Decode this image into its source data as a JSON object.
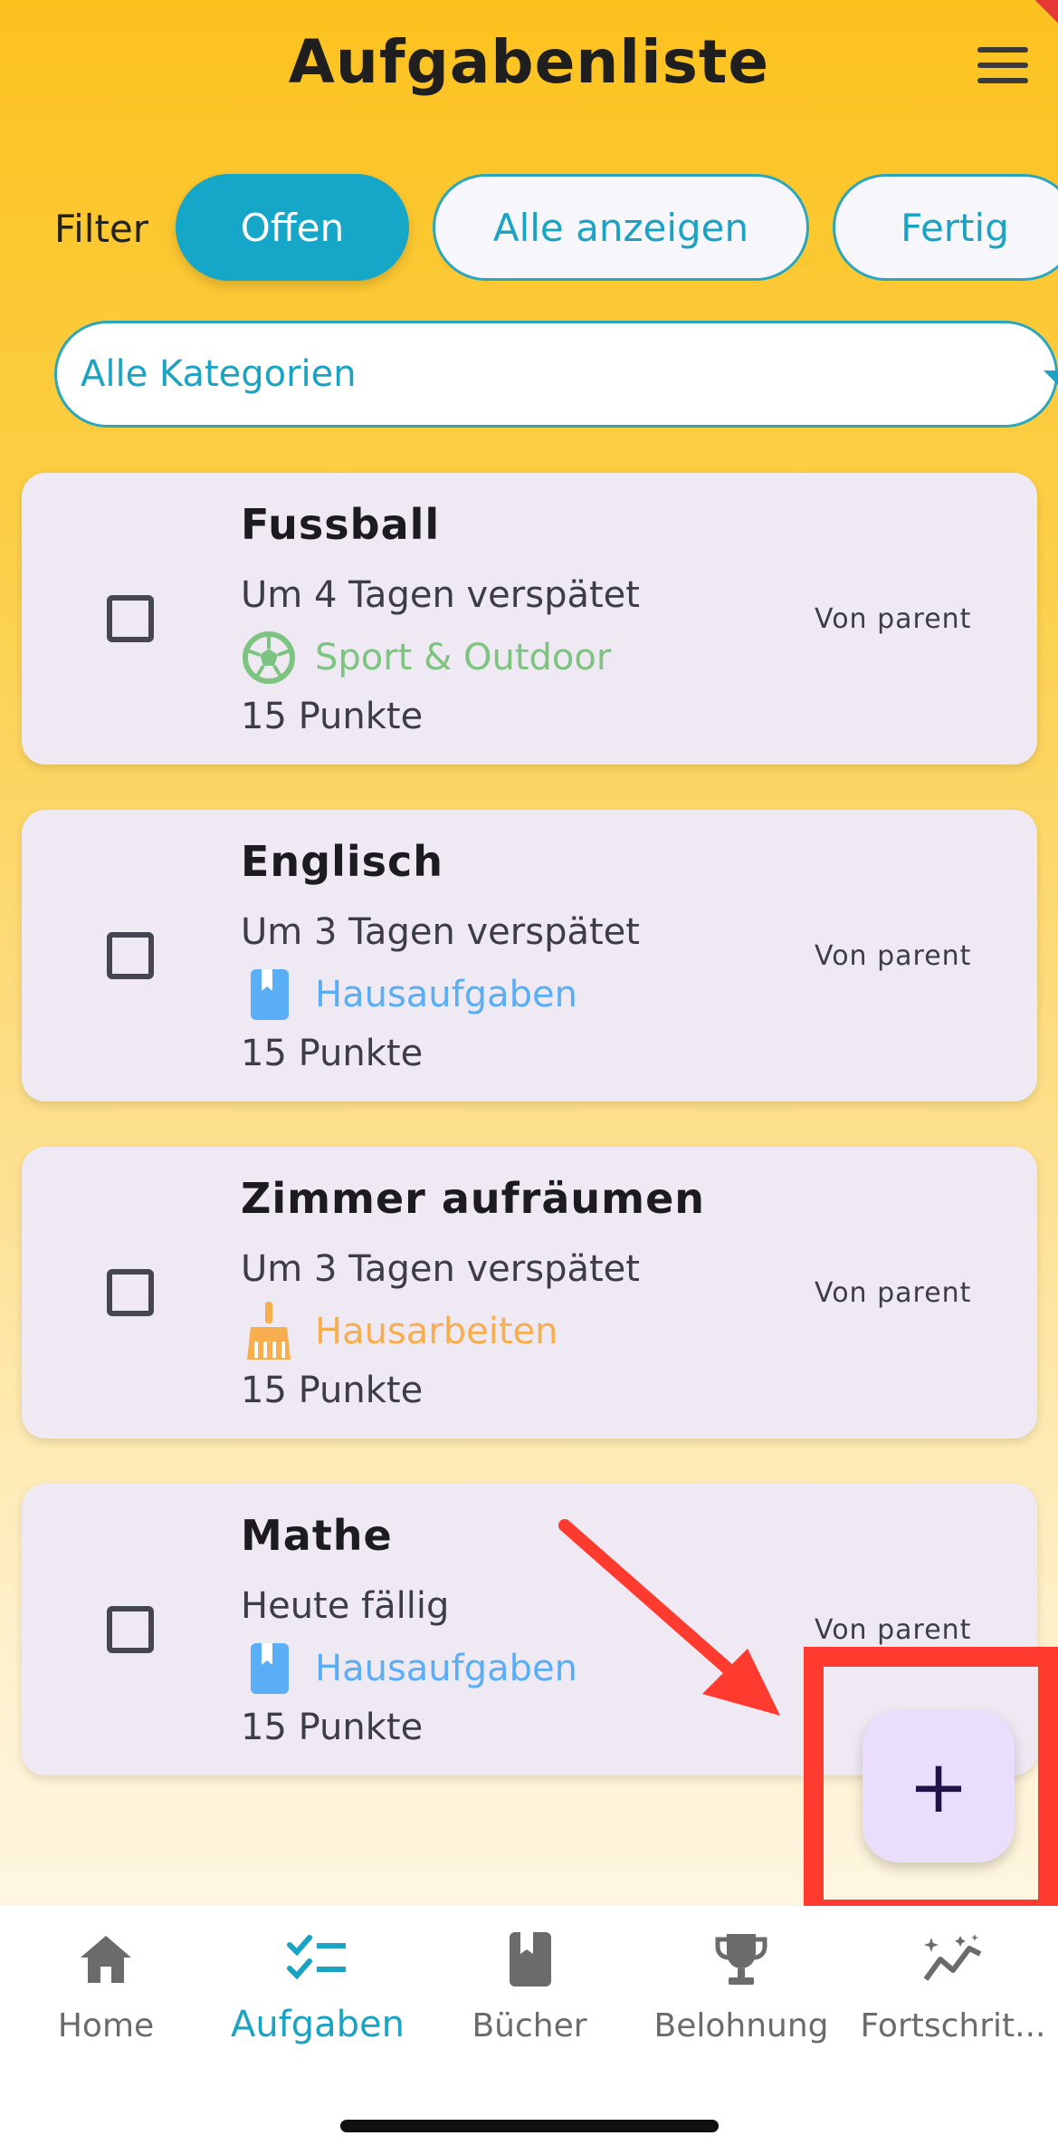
{
  "header": {
    "title": "Aufgabenliste"
  },
  "filter": {
    "label": "Filter",
    "chips": [
      {
        "label": "Offen",
        "active": true
      },
      {
        "label": "Alle anzeigen",
        "active": false
      },
      {
        "label": "Fertig",
        "active": false
      }
    ],
    "category_dropdown": "Alle Kategorien"
  },
  "tasks": [
    {
      "title": "Fussball",
      "due": "Um 4 Tagen verspätet",
      "category": "Sport & Outdoor",
      "category_icon": "soccer-ball-icon",
      "category_color": "#7cc47f",
      "points": "15 Punkte",
      "from": "Von parent"
    },
    {
      "title": "Englisch",
      "due": "Um 3 Tagen verspätet",
      "category": "Hausaufgaben",
      "category_icon": "book-icon",
      "category_color": "#5aaef5",
      "points": "15 Punkte",
      "from": "Von parent"
    },
    {
      "title": "Zimmer aufräumen",
      "due": "Um 3 Tagen verspätet",
      "category": "Hausarbeiten",
      "category_icon": "broom-icon",
      "category_color": "#f6ae4e",
      "points": "15 Punkte",
      "from": "Von parent"
    },
    {
      "title": "Mathe",
      "due": "Heute fällig",
      "category": "Hausaufgaben",
      "category_icon": "book-icon",
      "category_color": "#5aaef5",
      "points": "15 Punkte",
      "from": "Von parent"
    }
  ],
  "fab": {
    "label": "+"
  },
  "bottom_nav": [
    {
      "label": "Home",
      "icon": "home-icon",
      "active": false
    },
    {
      "label": "Aufgaben",
      "icon": "checklist-icon",
      "active": true
    },
    {
      "label": "Bücher",
      "icon": "book-icon",
      "active": false
    },
    {
      "label": "Belohnung",
      "icon": "trophy-icon",
      "active": false
    },
    {
      "label": "Fortschrit...",
      "icon": "progress-chart-icon",
      "active": false
    }
  ],
  "colors": {
    "accent": "#16a6c8",
    "highlight": "#ff3b30",
    "card_bg": "#efe9f3"
  }
}
